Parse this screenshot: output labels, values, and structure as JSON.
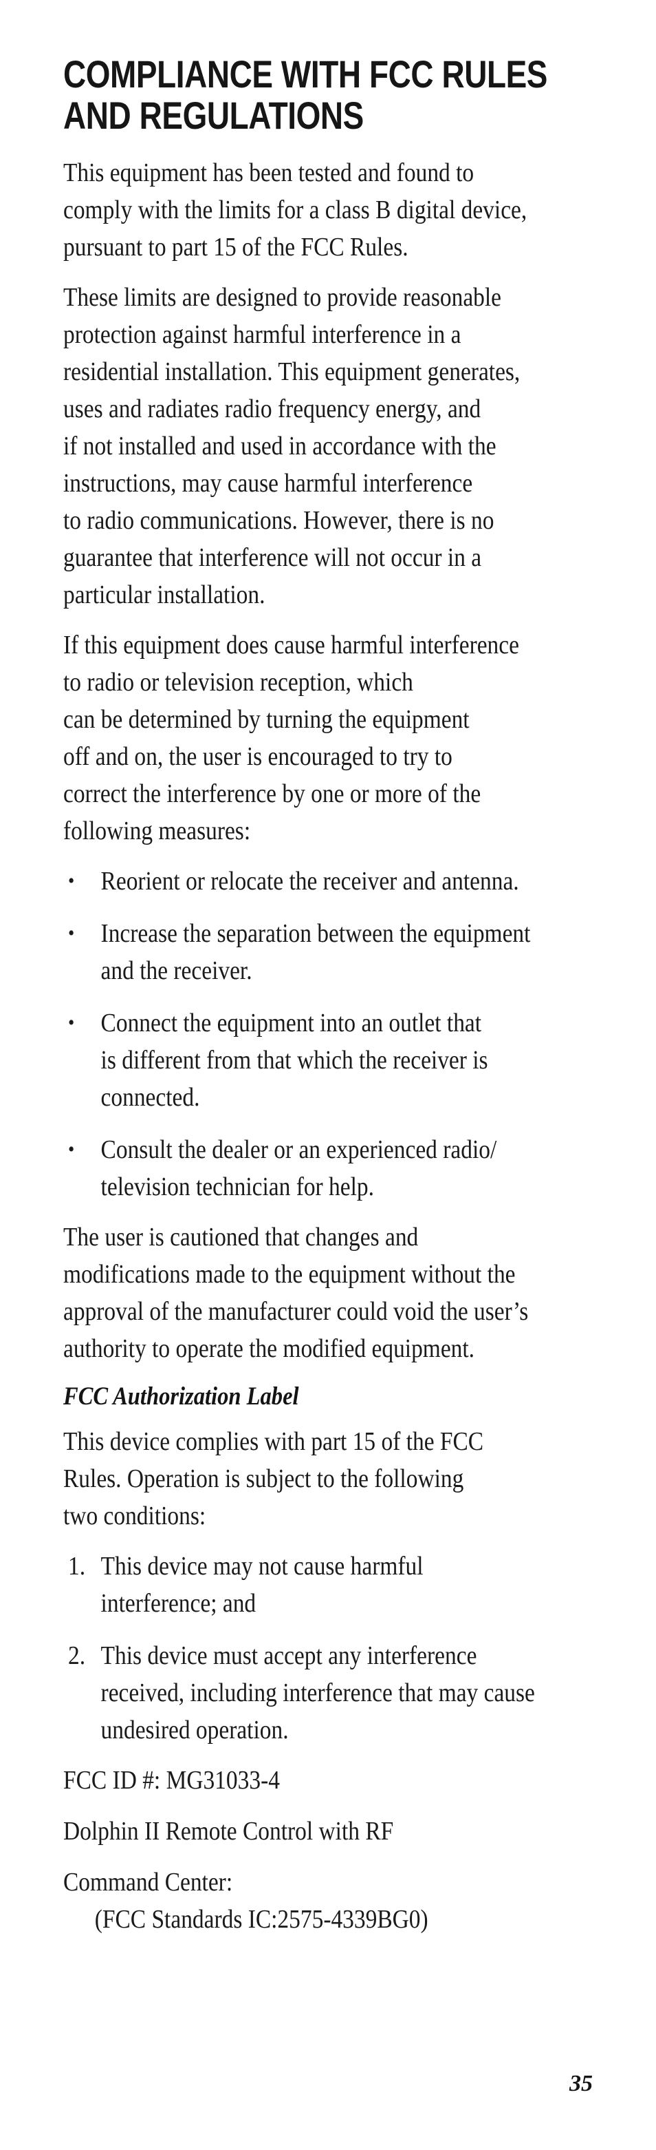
{
  "document": {
    "title_lines": [
      "COMPLIANCE WITH FCC RULES",
      "AND REGULATIONS"
    ],
    "page_number": "35"
  },
  "paragraphs": {
    "p1": [
      "This equipment has been tested and found to",
      "comply with the limits for a class B digital device,",
      "pursuant to part 15 of the FCC Rules."
    ],
    "p2": [
      "These limits are designed to provide reasonable",
      "protection against harmful interference in a",
      "residential installation. This equipment generates,",
      "uses and radiates radio frequency energy, and",
      "if not installed and used in accordance with the",
      "instructions, may cause harmful interference",
      "to radio communications. However, there is no",
      "guarantee that interference will not occur in a",
      "particular installation."
    ],
    "p3": [
      "If this equipment does cause harmful interference",
      "to radio or television reception, which",
      "can be determined by turning the equipment",
      "off and on, the user is encouraged to try to",
      "correct the interference by one or more of the",
      "following measures:"
    ],
    "p4": [
      "The user is cautioned that changes and",
      "modifications made to the equipment without the",
      "approval of the manufacturer could void the user’s",
      "authority to operate the modified equipment."
    ],
    "p5": [
      "This device complies with part 15 of the FCC",
      "Rules. Operation is subject to the following",
      "two conditions:"
    ]
  },
  "bullet_list": {
    "marker": "•",
    "items": [
      {
        "lines": [
          "Reorient or relocate the receiver and antenna."
        ]
      },
      {
        "lines": [
          "Increase the separation between the equipment",
          "and the receiver."
        ]
      },
      {
        "lines": [
          "Connect the equipment into an outlet that",
          "is different from that which the receiver is",
          "connected."
        ]
      },
      {
        "lines": [
          "Consult the dealer or an experienced radio/",
          "television technician for help."
        ]
      }
    ]
  },
  "subheading": {
    "text": "FCC Authorization Label"
  },
  "numbered_list": {
    "items": [
      {
        "marker": "1.",
        "lines": [
          "This device may not cause harmful",
          "interference; and"
        ]
      },
      {
        "marker": "2.",
        "lines": [
          "This device must accept any interference",
          "received, including interference that may cause",
          "undesired operation."
        ]
      }
    ]
  },
  "footer_info": {
    "fcc_id": "FCC ID #: MG31033-4",
    "product": "Dolphin II Remote Control with RF",
    "command_center": "Command Center:",
    "standards": "(FCC Standards IC:2575-4339BG0)"
  }
}
